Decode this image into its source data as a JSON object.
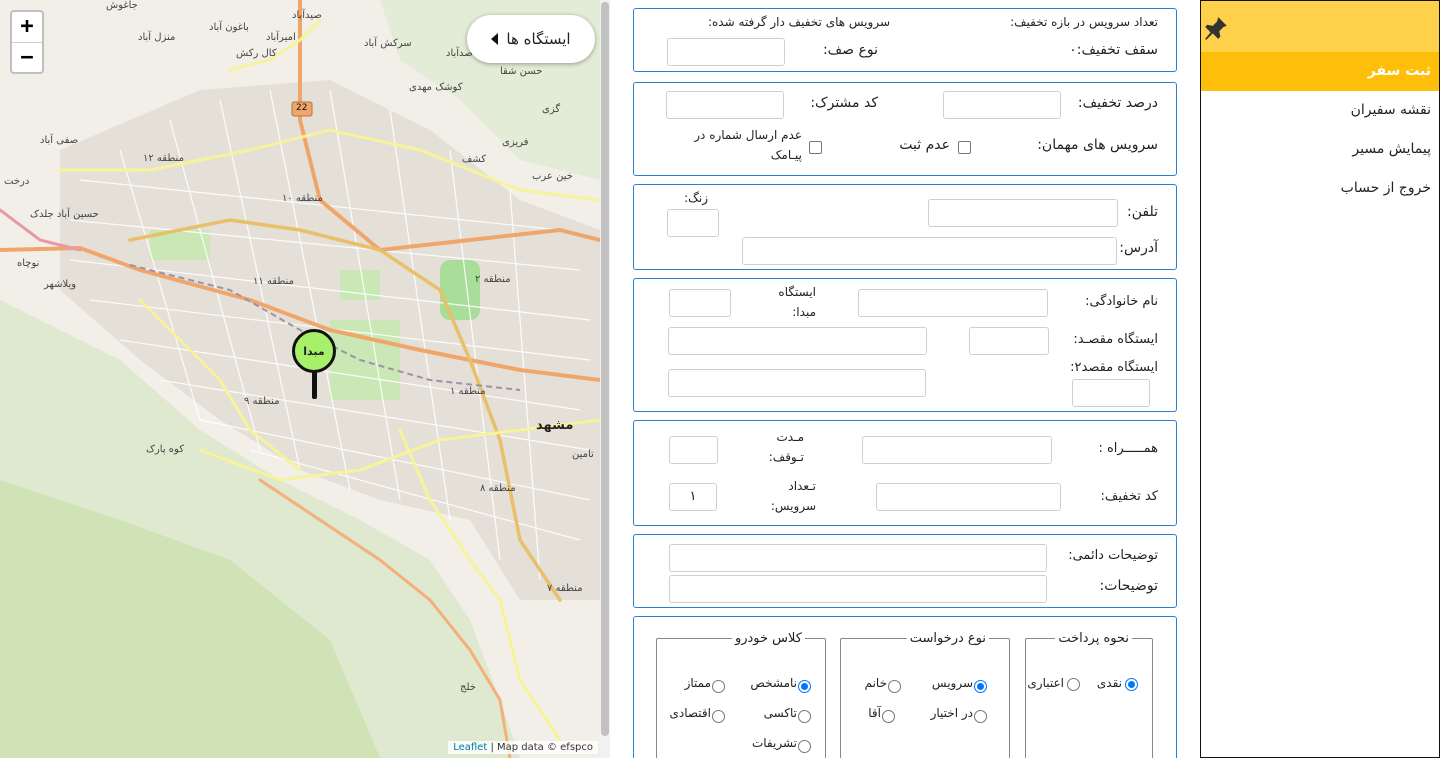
{
  "map": {
    "zoom_in": "+",
    "zoom_out": "−",
    "stations_button": "ایستگاه ها",
    "pin_label": "مبدا",
    "attribution_link": "Leaflet",
    "attribution_text": "| Map data © efspco",
    "labels": {
      "mashhad": "مشهد",
      "region12": "منطقه ۱۲",
      "region10": "منطقه ۱۰",
      "region11": "منطقه ۱۱",
      "region9": "منطقه ۹",
      "region2": "منطقه ۲",
      "region1": "منطقه ۱",
      "region8": "منطقه ۸",
      "region7": "منطقه ۷",
      "jaghoosh": "جاغوش",
      "sidabad": "صیدآباد",
      "baghvan": "باغون آباد",
      "manzelabad": "منزل آباد",
      "amirabad": "امیرآباد",
      "kalrakhsh": "کال رکش",
      "saddabad": "صدآباد",
      "sarkhsabad": "سرکش آباد",
      "kooshk": "کوشک مهدی",
      "hesshagha": "حسن شقا",
      "gazi": "گزی",
      "farizi": "فریزی",
      "kashf": "کشف",
      "khinarab": "خین عرب",
      "safiabad": "صفی آباد",
      "derakht": "درخت",
      "hosseinabad": "حسین آباد جلدک",
      "noqab": "نوچاه",
      "vilashahr": "ویلاشهر",
      "kooh_park": "کوه پارک",
      "tamin": "تامین",
      "khalaj": "خلج",
      "road22": "22"
    }
  },
  "form": {
    "discount_info": {
      "count_label": "تعداد سرویس در بازه تخفیف:",
      "services_label": "سرویس های تخفیف دار گرفته شده:",
      "cap_label": "سقف تخفیف:۰",
      "queue_label": "نوع صف:"
    },
    "customer": {
      "discount_percent_label": "درصد تخفیف:",
      "customer_code_label": "کد مشترک:",
      "guest_services_label": "سرویس های مهمان:",
      "no_register_label": "عدم ثبت",
      "no_sms_label_1": "عدم ارسال شماره در",
      "no_sms_label_2": "پیـامک"
    },
    "contact": {
      "phone_label": "تلفن:",
      "bell_label": "زنگ:",
      "address_label": "آدرس:"
    },
    "stations": {
      "family_label": "نام خانوادگی:",
      "origin_label_1": "ایستگاه",
      "origin_label_2": "مبدا:",
      "dest_label": "ایستگاه مقصـد:",
      "dest2_label": "ایستگاه مقصد۲:"
    },
    "extra": {
      "companion_label": "همـــــراه :",
      "stop_label_1": "مـدت",
      "stop_label_2": "تـوقف:",
      "discount_code_label": "کد تخفیف:",
      "service_count_label_1": "تـعداد",
      "service_count_label_2": "سرویس:",
      "service_count_value": "۱"
    },
    "notes": {
      "permanent_label": "توضیحات دائمی:",
      "notes_label": "توضیحات:"
    },
    "options": {
      "payment_legend": "نحوه پرداخت",
      "payment_cash": "نقدی",
      "payment_credit": "اعتباری",
      "request_legend": "نوع درخواست",
      "request_service": "سرویس",
      "request_lady": "خانم",
      "request_available": "در اختیار",
      "request_sir": "آقا",
      "class_legend": "کلاس خودرو",
      "class_unknown": "نامشخص",
      "class_premium": "ممتاز",
      "class_taxi": "تاکسی",
      "class_economy": "اقتصادی",
      "class_ceremonial": "تشریفات"
    }
  },
  "sidebar": {
    "items": [
      "ثبت سفر",
      "نقشه سفیران",
      "پیمایش مسیر",
      "خروج از حساب"
    ],
    "active_index": 0
  },
  "colors": {
    "accent_border": "#2a7fd4",
    "sidebar_header": "#ffd04a",
    "sidebar_active": "#ffbe0a",
    "pin_fill": "#a6f06a"
  }
}
